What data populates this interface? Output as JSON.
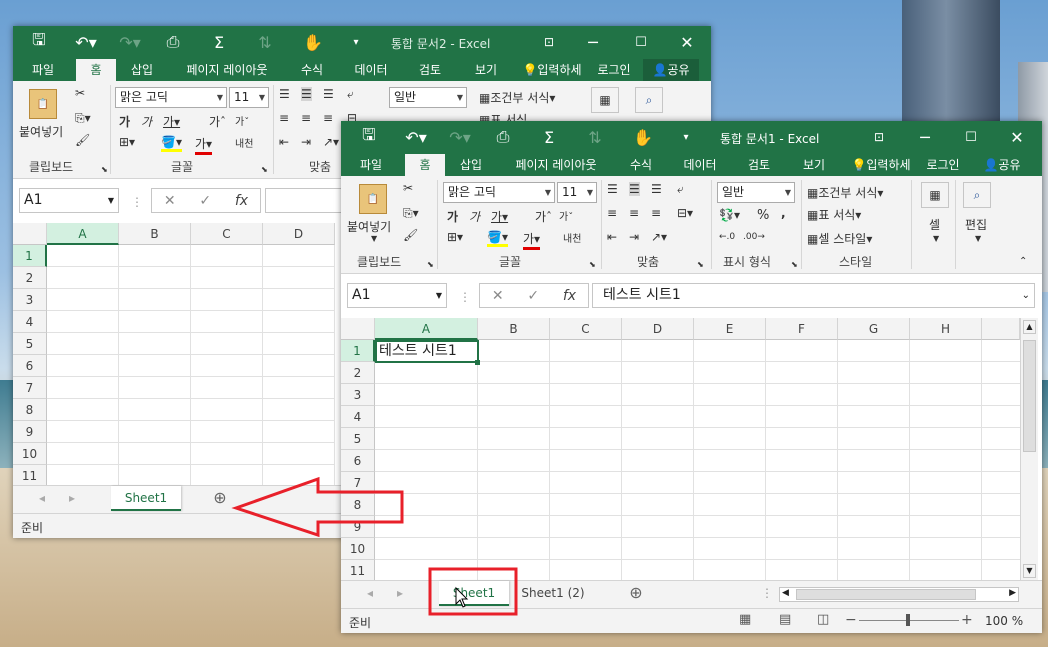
{
  "win2": {
    "title": "통합 문서2 - Excel",
    "tabs": [
      "파일",
      "홈",
      "삽입",
      "페이지 레이아웃",
      "수식",
      "데이터",
      "검토",
      "보기"
    ],
    "tell_me": "입력하세",
    "login": "로그인",
    "share": "공유",
    "font": "맑은 고딕",
    "size": "11",
    "paste": "붙여넣기",
    "groups": [
      "클립보드",
      "글꼴",
      "맞춤"
    ],
    "wrap": "내천",
    "namebox": "A1",
    "cols": [
      "A",
      "B",
      "C",
      "D"
    ],
    "rows": [
      "1",
      "2",
      "3",
      "4",
      "5",
      "6",
      "7",
      "8",
      "9",
      "10",
      "11"
    ],
    "sheet": "Sheet1",
    "status": "준비",
    "cond_fmt": "조건부 서식",
    "table_fmt": "표 서식",
    "number": "일반"
  },
  "win1": {
    "title": "통합 문서1 - Excel",
    "tabs": [
      "파일",
      "홈",
      "삽입",
      "페이지 레이아웃",
      "수식",
      "데이터",
      "검토",
      "보기"
    ],
    "tell_me": "입력하세",
    "login": "로그인",
    "share": "공유",
    "font": "맑은 고딕",
    "size": "11",
    "paste": "붙여넣기",
    "number": "일반",
    "cond_fmt": "조건부 서식",
    "table_fmt": "표 서식",
    "cell_style": "셀 스타일",
    "cells": "셀",
    "edit": "편집",
    "groups": [
      "클립보드",
      "글꼴",
      "맞춤",
      "표시 형식",
      "스타일"
    ],
    "wrap": "내천",
    "namebox": "A1",
    "formula": "테스트 시트1",
    "cols": [
      "A",
      "B",
      "C",
      "D",
      "E",
      "F",
      "G",
      "H"
    ],
    "rows": [
      "1",
      "2",
      "3",
      "4",
      "5",
      "6",
      "7",
      "8",
      "9",
      "10",
      "11"
    ],
    "a1": "테스트 시트1",
    "sheets": [
      "Sheet1",
      "Sheet1 (2)"
    ],
    "status": "준비",
    "zoom": "100 %"
  },
  "colors": {
    "excel_green": "#217346",
    "annotation_red": "#e8202a"
  }
}
